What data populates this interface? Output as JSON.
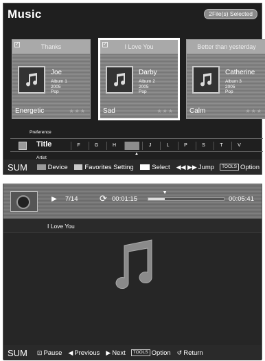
{
  "browser": {
    "title": "Music",
    "selected_badge": "2File(s) Selected",
    "cards": [
      {
        "header": "Thanks",
        "checked": true,
        "artist": "Joe",
        "album": "Album 1",
        "year": "2005",
        "genre": "Pop",
        "mood": "Energetic",
        "stars": "★★★"
      },
      {
        "header": "I Love You",
        "checked": true,
        "artist": "Darby",
        "album": "Album 2",
        "year": "2005",
        "genre": "Pop",
        "mood": "Sad",
        "stars": "★★★"
      },
      {
        "header": "Better than yesterday",
        "checked": false,
        "artist": "Catherine",
        "album": "Album 3",
        "year": "2005",
        "genre": "Pop",
        "mood": "Calm",
        "stars": "★★★"
      }
    ],
    "sort": {
      "preference_label": "Preference",
      "current": "Title",
      "artist_label": "Artist",
      "letters": [
        "F",
        "G",
        "H",
        "",
        "J",
        "L",
        "P",
        "S",
        "T",
        "V"
      ],
      "highlight_index": 3
    },
    "bottom_bar": {
      "sum": "SUM",
      "device": "Device",
      "favorites": "Favorites Setting",
      "select": "Select",
      "jump_symbol": "◀◀ ▶▶",
      "jump": "Jump",
      "tools": "TOOLS",
      "option": "Option"
    }
  },
  "player": {
    "track_position": "7/14",
    "elapsed": "00:01:15",
    "total": "00:05:41",
    "progress": 0.22,
    "song_title": "I Love You",
    "bottom_bar": {
      "sum": "SUM",
      "pause": "Pause",
      "previous": "Previous",
      "next": "Next",
      "tools": "TOOLS",
      "option": "Option",
      "return": "Return"
    }
  }
}
